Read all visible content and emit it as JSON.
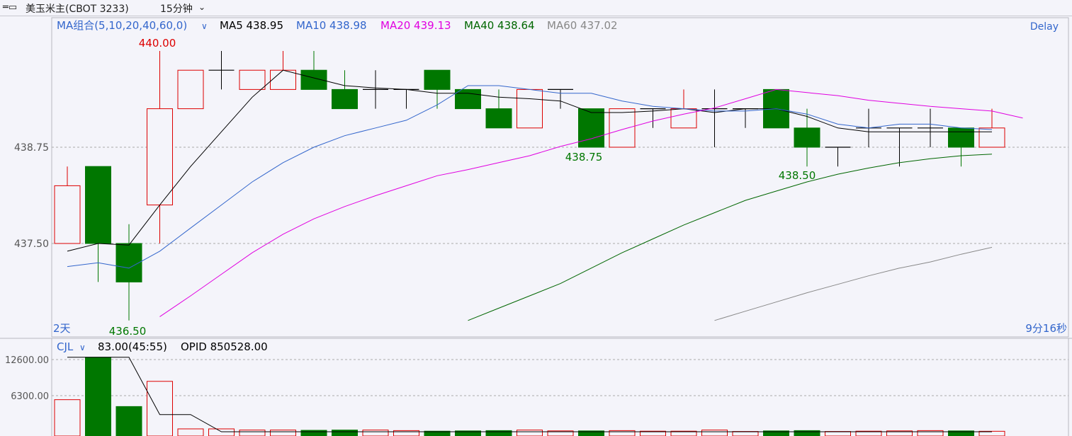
{
  "header": {
    "link_icon": "link-icon",
    "symbol": "美玉米主(CBOT  3233)",
    "period": "15分钟"
  },
  "price_panel": {
    "indicator_name": "MA组合(5,10,20,40,60,0)",
    "delay": "Delay",
    "ma_values": [
      {
        "label": "MA5 438.95",
        "color": "#000000"
      },
      {
        "label": "MA10 438.98",
        "color": "#3366cc"
      },
      {
        "label": "MA20 439.13",
        "color": "#e000e0"
      },
      {
        "label": "MA40 438.64",
        "color": "#006600"
      },
      {
        "label": "MA60 437.02",
        "color": "#888888"
      }
    ],
    "y_ticks": [
      "438.75",
      "437.50"
    ],
    "high_label": "440.00",
    "low_labels": [
      "438.75",
      "438.50",
      "436.50"
    ],
    "bottom_left": "2天",
    "bottom_right": "9分16秒"
  },
  "volume_panel": {
    "indicator_name": "CJL",
    "value_text": "83.00(45:55)",
    "opid_text": "OPID 850528.00",
    "y_ticks": [
      "12600.00",
      "6300.00"
    ]
  },
  "colors": {
    "up": "#dd0000",
    "down": "#007700",
    "background": "#f4f4fa",
    "grid": "#aaaaaa"
  },
  "chart_data": {
    "type": "candlestick",
    "y_ticks": [
      438.75,
      437.5
    ],
    "candles": [
      {
        "o": 437.5,
        "c": 438.25,
        "h": 438.5,
        "l": 437.5
      },
      {
        "o": 438.5,
        "c": 437.5,
        "h": 438.5,
        "l": 437.0
      },
      {
        "o": 437.5,
        "c": 437.0,
        "h": 437.75,
        "l": 436.5
      },
      {
        "o": 438.0,
        "c": 439.25,
        "h": 440.0,
        "l": 437.5
      },
      {
        "o": 439.25,
        "c": 439.75,
        "h": 439.75,
        "l": 439.25
      },
      {
        "o": 439.75,
        "c": 439.75,
        "h": 440.0,
        "l": 439.5
      },
      {
        "o": 439.5,
        "c": 439.75,
        "h": 439.75,
        "l": 439.5
      },
      {
        "o": 439.5,
        "c": 439.75,
        "h": 440.0,
        "l": 439.5
      },
      {
        "o": 439.75,
        "c": 439.5,
        "h": 440.0,
        "l": 439.5
      },
      {
        "o": 439.5,
        "c": 439.25,
        "h": 439.75,
        "l": 439.25
      },
      {
        "o": 439.5,
        "c": 439.5,
        "h": 439.75,
        "l": 439.25
      },
      {
        "o": 439.5,
        "c": 439.5,
        "h": 439.5,
        "l": 439.25
      },
      {
        "o": 439.75,
        "c": 439.5,
        "h": 439.75,
        "l": 439.25
      },
      {
        "o": 439.5,
        "c": 439.25,
        "h": 439.5,
        "l": 439.25
      },
      {
        "o": 439.25,
        "c": 439.0,
        "h": 439.5,
        "l": 439.0
      },
      {
        "o": 439.0,
        "c": 439.5,
        "h": 439.5,
        "l": 439.0
      },
      {
        "o": 439.5,
        "c": 439.5,
        "h": 439.5,
        "l": 439.25
      },
      {
        "o": 439.25,
        "c": 438.75,
        "h": 439.25,
        "l": 438.75
      },
      {
        "o": 438.75,
        "c": 439.25,
        "h": 439.25,
        "l": 438.75
      },
      {
        "o": 439.25,
        "c": 439.25,
        "h": 439.25,
        "l": 439.0
      },
      {
        "o": 439.0,
        "c": 439.25,
        "h": 439.5,
        "l": 439.0
      },
      {
        "o": 439.25,
        "c": 439.25,
        "h": 439.5,
        "l": 438.75
      },
      {
        "o": 439.25,
        "c": 439.25,
        "h": 439.25,
        "l": 439.0
      },
      {
        "o": 439.5,
        "c": 439.0,
        "h": 439.5,
        "l": 439.0
      },
      {
        "o": 439.0,
        "c": 438.75,
        "h": 439.25,
        "l": 438.5
      },
      {
        "o": 438.75,
        "c": 438.75,
        "h": 438.75,
        "l": 438.5
      },
      {
        "o": 439.0,
        "c": 439.0,
        "h": 439.25,
        "l": 438.75
      },
      {
        "o": 439.0,
        "c": 439.0,
        "h": 439.0,
        "l": 438.5
      },
      {
        "o": 439.0,
        "c": 439.0,
        "h": 439.25,
        "l": 438.75
      },
      {
        "o": 439.0,
        "c": 438.75,
        "h": 439.0,
        "l": 438.5
      },
      {
        "o": 438.75,
        "c": 439.0,
        "h": 439.25,
        "l": 438.75
      }
    ],
    "ma": [
      {
        "name": "MA5",
        "color": "#000000",
        "start": 0,
        "values": [
          437.4,
          437.5,
          437.48,
          438.0,
          438.5,
          438.95,
          439.4,
          439.75,
          439.65,
          439.55,
          439.52,
          439.5,
          439.45,
          439.45,
          439.4,
          439.38,
          439.35,
          439.2,
          439.2,
          439.22,
          439.25,
          439.2,
          439.25,
          439.25,
          439.15,
          439.0,
          438.95,
          438.95,
          438.95,
          438.95,
          438.95
        ]
      },
      {
        "name": "MA10",
        "color": "#3366cc",
        "start": 0,
        "values": [
          437.2,
          437.25,
          437.18,
          437.4,
          437.7,
          438.0,
          438.3,
          438.55,
          438.75,
          438.9,
          439.0,
          439.1,
          439.3,
          439.55,
          439.55,
          439.5,
          439.45,
          439.45,
          439.35,
          439.28,
          439.25,
          439.22,
          439.22,
          439.25,
          439.18,
          439.05,
          439.0,
          439.05,
          439.05,
          439.0,
          438.98
        ]
      },
      {
        "name": "MA20",
        "color": "#e000e0",
        "start": 3,
        "values": [
          436.55,
          436.82,
          437.1,
          437.38,
          437.62,
          437.82,
          437.98,
          438.12,
          438.25,
          438.38,
          438.46,
          438.55,
          438.64,
          438.76,
          438.86,
          438.98,
          439.09,
          439.18,
          439.26,
          439.38,
          439.5,
          439.46,
          439.42,
          439.36,
          439.32,
          439.28,
          439.25,
          439.22,
          439.13
        ]
      },
      {
        "name": "MA40",
        "color": "#006600",
        "start": 13,
        "values": [
          436.5,
          436.66,
          436.82,
          436.98,
          437.18,
          437.38,
          437.56,
          437.74,
          437.9,
          438.06,
          438.18,
          438.3,
          438.4,
          438.48,
          438.55,
          438.6,
          438.64,
          438.66
        ]
      },
      {
        "name": "MA60",
        "color": "#888888",
        "start": 21,
        "values": [
          436.5,
          436.62,
          436.74,
          436.86,
          436.97,
          437.08,
          437.18,
          437.26,
          437.36,
          437.45
        ]
      }
    ],
    "volume": {
      "values": [
        5600,
        13000,
        4400,
        8800,
        500,
        500,
        300,
        300,
        250,
        300,
        300,
        200,
        100,
        150,
        200,
        300,
        150,
        150,
        200,
        100,
        100,
        300,
        50,
        150,
        200,
        50,
        100,
        150,
        200,
        150,
        83
      ],
      "ylim_label_values": [
        12600,
        6300
      ],
      "line": [
        13000,
        13000,
        13000,
        3000,
        3000,
        0,
        0,
        0,
        0,
        0,
        0,
        0,
        0,
        0,
        0,
        0,
        0,
        0,
        0,
        0,
        0,
        0,
        0,
        0,
        0,
        0,
        0,
        0,
        0,
        0,
        0
      ]
    }
  }
}
